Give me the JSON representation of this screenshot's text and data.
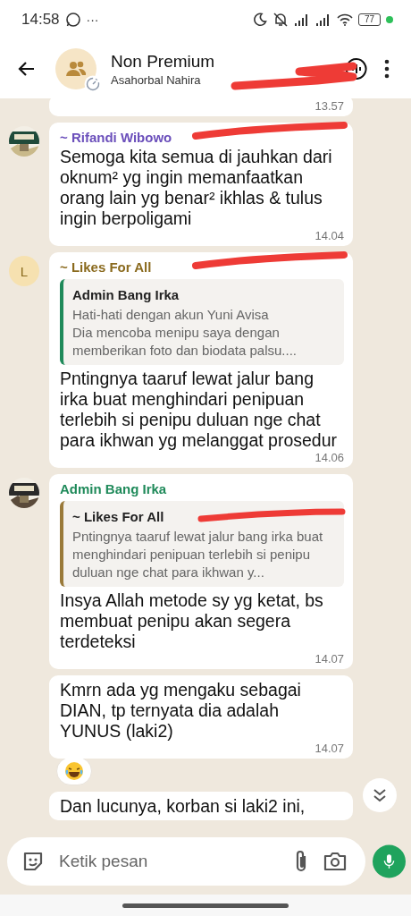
{
  "status_bar": {
    "time": "14:58",
    "more": "···",
    "battery": "77"
  },
  "header": {
    "title": "Non Premium",
    "subtitle": "Asahorbal Nahira",
    "redacted": true
  },
  "messages": [
    {
      "kind": "plain",
      "time": "13.57"
    },
    {
      "kind": "named",
      "sender": "~ Rifandi Wibowo",
      "color": "#6b4fbb",
      "text": "Semoga kita semua di jauhkan dari oknum² yg ingin memanfaatkan orang lain yg benar² ikhlas & tulus ingin berpoligami",
      "time": "14.04",
      "redacted": true
    },
    {
      "kind": "named",
      "avatar": {
        "kind": "letter",
        "letter": "L"
      },
      "sender": "~ Likes For All",
      "color": "#8a6a1e",
      "redacted": true,
      "quote": {
        "sender": "Admin Bang Irka",
        "color": "#1f8a5a",
        "text": "Hati-hati dengan akun Yuni Avisa\nDia mencoba menipu saya dengan memberikan foto dan biodata palsu...."
      },
      "text": "Pntingnya taaruf lewat jalur bang irka buat menghindari penipuan terlebih si penipu duluan nge chat para ikhwan yg melanggat prosedur",
      "time": "14.06"
    },
    {
      "kind": "named",
      "sender": "Admin Bang Irka",
      "color": "#1f8a5a",
      "quote": {
        "sender": "~ Likes For All",
        "redacted": true,
        "color": "#9a7a3a",
        "text": "Pntingnya taaruf lewat jalur bang irka buat menghindari penipuan terlebih si penipu duluan nge chat para ikhwan y..."
      },
      "text": "Insya Allah metode sy yg ketat, bs membuat penipu akan segera terdeteksi",
      "time": "14.07"
    },
    {
      "kind": "plain",
      "text": "Kmrn ada yg mengaku sebagai DIAN, tp ternyata dia adalah YUNUS (laki2)",
      "time": "14.07",
      "reaction": {
        "kind": "laugh"
      }
    },
    {
      "kind": "plain",
      "text": "Dan lucunya, korban si laki2 ini,"
    }
  ],
  "composer": {
    "placeholder": "Ketik pesan"
  }
}
